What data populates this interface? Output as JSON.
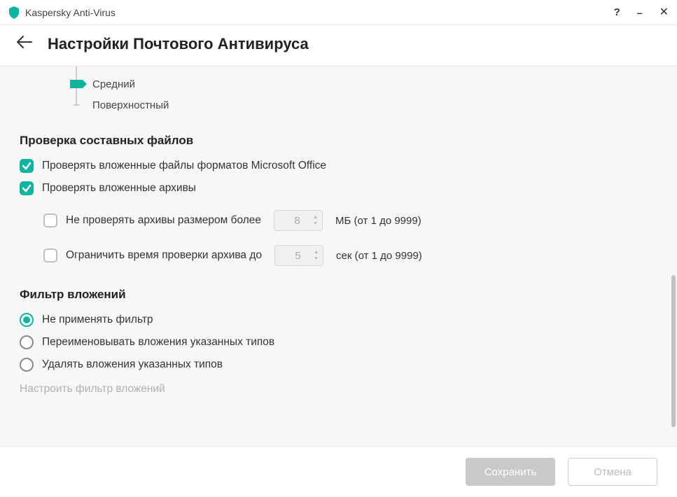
{
  "titlebar": {
    "app_name": "Kaspersky Anti-Virus"
  },
  "header": {
    "title": "Настройки Почтового Антивируса"
  },
  "security_level": {
    "options": [
      {
        "label": "Средний",
        "selected": true
      },
      {
        "label": "Поверхностный",
        "selected": false
      }
    ]
  },
  "compound_files": {
    "title": "Проверка составных файлов",
    "check_office": "Проверять вложенные файлы форматов Microsoft Office",
    "check_archives": "Проверять вложенные архивы",
    "skip_large": {
      "label": "Не проверять архивы размером более",
      "value": "8",
      "unit": "МБ (от 1 до 9999)"
    },
    "limit_time": {
      "label": "Ограничить время проверки архива до",
      "value": "5",
      "unit": "сек (от 1 до 9999)"
    }
  },
  "attachment_filter": {
    "title": "Фильтр вложений",
    "options": {
      "none": "Не применять фильтр",
      "rename": "Переименовывать вложения указанных типов",
      "delete": "Удалять вложения указанных типов"
    },
    "configure_link": "Настроить фильтр вложений"
  },
  "footer": {
    "save": "Сохранить",
    "cancel": "Отмена"
  }
}
